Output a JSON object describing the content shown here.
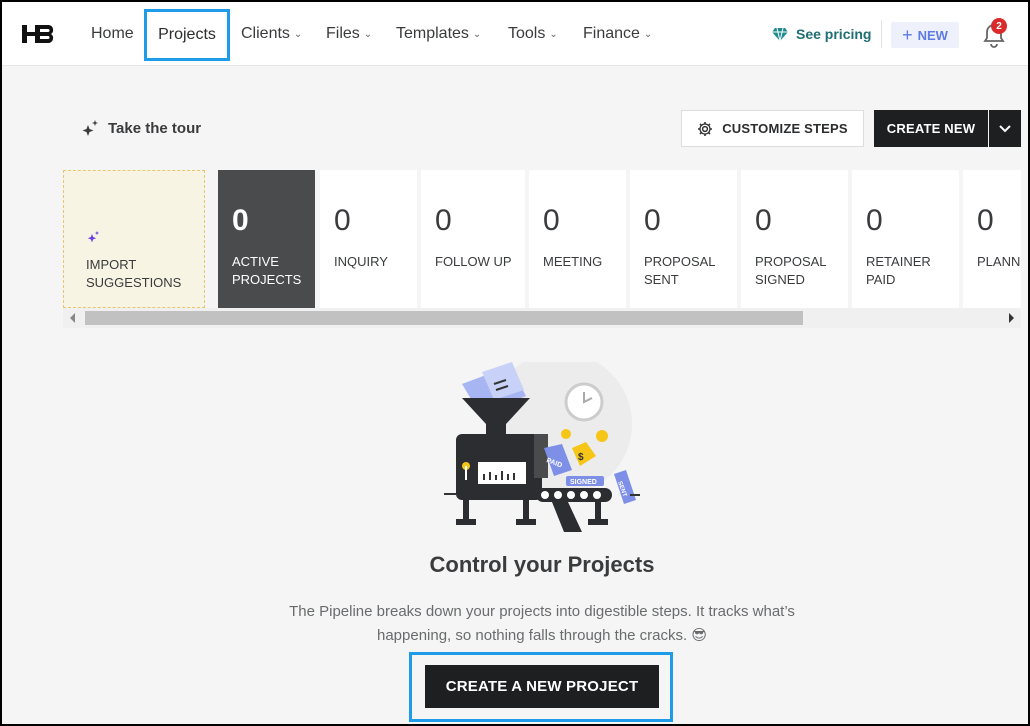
{
  "nav": {
    "items": [
      {
        "label": "Home",
        "dropdown": false
      },
      {
        "label": "Projects",
        "dropdown": false,
        "active": true
      },
      {
        "label": "Clients",
        "dropdown": true
      },
      {
        "label": "Files",
        "dropdown": true
      },
      {
        "label": "Templates",
        "dropdown": true
      },
      {
        "label": "Tools",
        "dropdown": true
      },
      {
        "label": "Finance",
        "dropdown": true
      }
    ],
    "see_pricing": "See pricing",
    "new_label": "NEW",
    "notification_count": "2",
    "brand_color": "#1f6f73",
    "highlight_color": "#1e9ce8"
  },
  "toolbar": {
    "tour_label": "Take the tour",
    "customize_label": "CUSTOMIZE STEPS",
    "create_new_label": "CREATE NEW"
  },
  "pipeline": {
    "import_line1": "IMPORT",
    "import_line2": "SUGGESTIONS",
    "stages": [
      {
        "count": "0",
        "line1": "ACTIVE",
        "line2": "PROJECTS",
        "active": true
      },
      {
        "count": "0",
        "line1": "INQUIRY",
        "line2": ""
      },
      {
        "count": "0",
        "line1": "FOLLOW UP",
        "line2": ""
      },
      {
        "count": "0",
        "line1": "MEETING",
        "line2": ""
      },
      {
        "count": "0",
        "line1": "PROPOSAL",
        "line2": "SENT"
      },
      {
        "count": "0",
        "line1": "PROPOSAL",
        "line2": "SIGNED"
      },
      {
        "count": "0",
        "line1": "RETAINER",
        "line2": "PAID"
      },
      {
        "count": "0",
        "line1": "PLANN",
        "line2": ""
      }
    ]
  },
  "empty_state": {
    "title": "Control your Projects",
    "desc_line1": "The Pipeline breaks down your projects into digestible steps. It tracks what’s",
    "desc_line2": "happening, so nothing falls through the cracks. 😎",
    "cta_label": "CREATE A NEW PROJECT",
    "illus_paid": "PAID",
    "illus_signed": "SIGNED",
    "illus_sent": "SENT"
  }
}
